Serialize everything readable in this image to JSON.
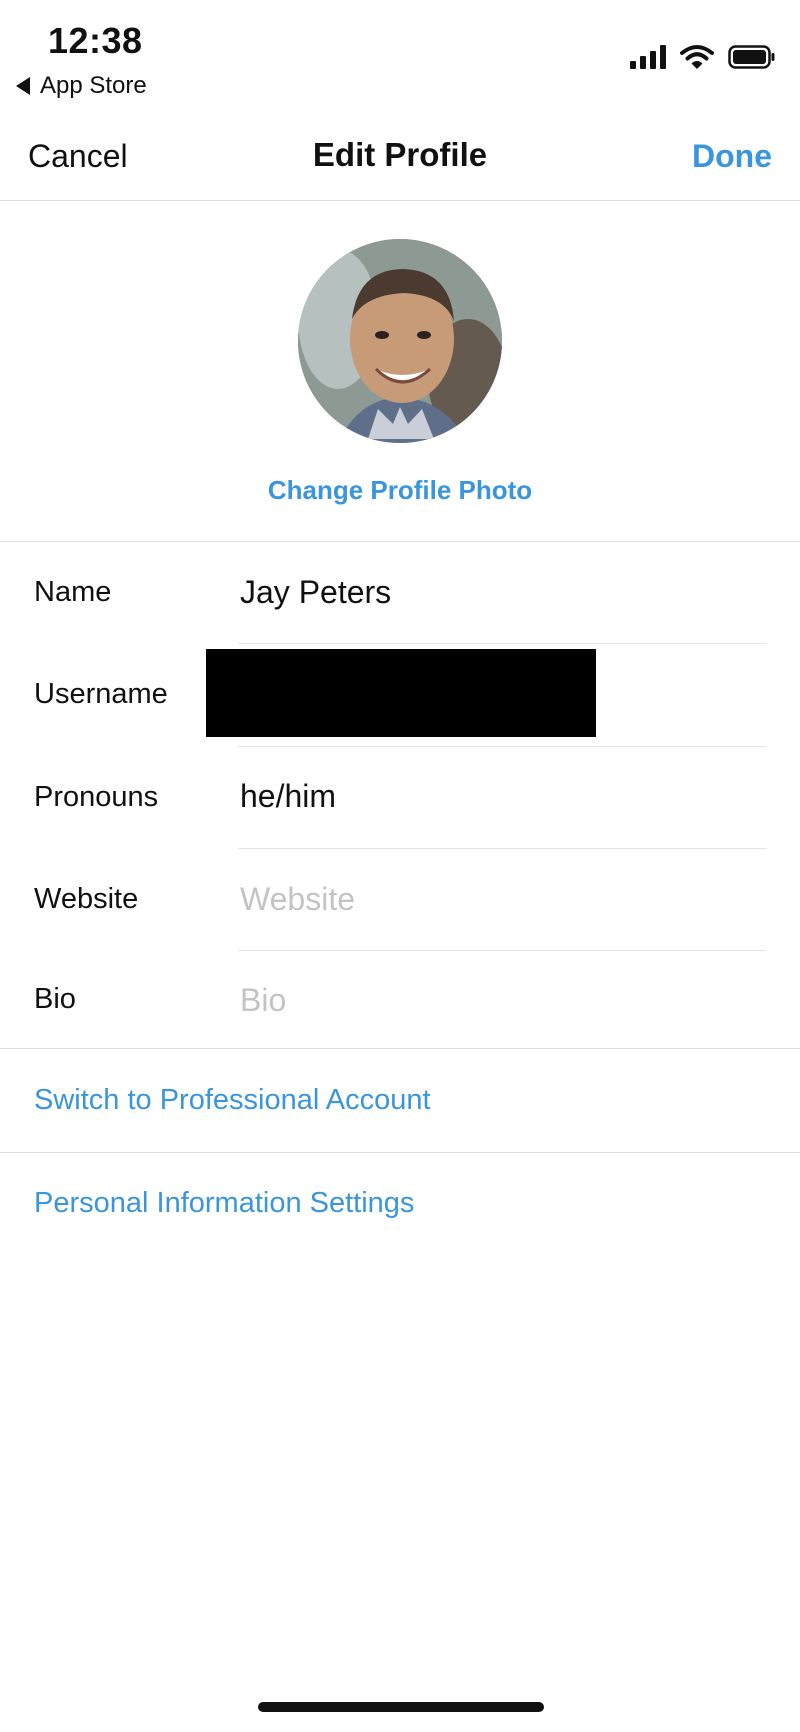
{
  "status_bar": {
    "time": "12:38",
    "back_app": "App Store",
    "icons": [
      "cellular-signal-icon",
      "wifi-icon",
      "battery-icon"
    ]
  },
  "nav": {
    "cancel": "Cancel",
    "title": "Edit Profile",
    "done": "Done"
  },
  "profile": {
    "change_photo": "Change Profile Photo"
  },
  "fields": {
    "name": {
      "label": "Name",
      "value": "Jay Peters"
    },
    "username": {
      "label": "Username",
      "value": ""
    },
    "pronouns": {
      "label": "Pronouns",
      "value": "he/him"
    },
    "website": {
      "label": "Website",
      "placeholder": "Website"
    },
    "bio": {
      "label": "Bio",
      "placeholder": "Bio"
    }
  },
  "links": {
    "professional": "Switch to Professional Account",
    "personal_info": "Personal Information Settings"
  },
  "colors": {
    "accent": "#3a96dc",
    "text": "#111111",
    "placeholder": "#c3c3c3"
  }
}
